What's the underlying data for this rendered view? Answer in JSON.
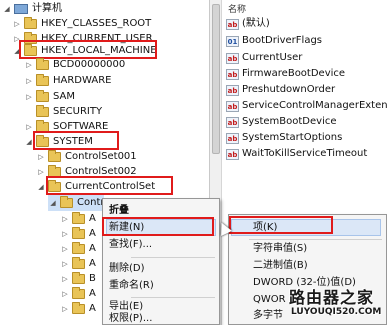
{
  "tree": {
    "root": "计算机",
    "items": [
      {
        "label": "HKEY_CLASSES_ROOT"
      },
      {
        "label": "HKEY_CURRENT_USER"
      },
      {
        "label": "HKEY_LOCAL_MACHINE"
      },
      {
        "label": "BCD00000000"
      },
      {
        "label": "HARDWARE"
      },
      {
        "label": "SAM"
      },
      {
        "label": "SECURITY"
      },
      {
        "label": "SOFTWARE"
      },
      {
        "label": "SYSTEM"
      },
      {
        "label": "ControlSet001"
      },
      {
        "label": "ControlSet002"
      },
      {
        "label": "CurrentControlSet"
      },
      {
        "label": "Contr"
      }
    ],
    "partial_labels": [
      "A",
      "A",
      "A",
      "A",
      "B",
      "A",
      "A",
      "A",
      "A"
    ]
  },
  "values_pane": {
    "header": "名称",
    "items": [
      {
        "label": "(默认)",
        "icon": "ab"
      },
      {
        "label": "BootDriverFlags",
        "icon": "binary"
      },
      {
        "label": "CurrentUser",
        "icon": "ab"
      },
      {
        "label": "FirmwareBootDevice",
        "icon": "ab"
      },
      {
        "label": "PreshutdownOrder",
        "icon": "ab"
      },
      {
        "label": "ServiceControlManagerExtension",
        "icon": "ab"
      },
      {
        "label": "SystemBootDevice",
        "icon": "ab"
      },
      {
        "label": "SystemStartOptions",
        "icon": "ab"
      },
      {
        "label": "WaitToKillServiceTimeout",
        "icon": "ab"
      }
    ]
  },
  "context_menu": {
    "items": [
      "折叠",
      "新建(N)",
      "查找(F)...",
      "删除(D)",
      "重命名(R)",
      "导出(E)",
      "权限(P)..."
    ]
  },
  "submenu": {
    "items": [
      "项(K)",
      "字符串值(S)",
      "二进制值(B)",
      "DWORD (32-位)值(D)",
      "QWOR",
      "多字节"
    ]
  },
  "watermark": {
    "logo": "路由器之家",
    "url": "LUYOUQI520.COM"
  },
  "colors": {
    "highlight_box": "#e01b1b",
    "menu_highlight": "#dbe7f7",
    "folder": "#e9c457"
  }
}
